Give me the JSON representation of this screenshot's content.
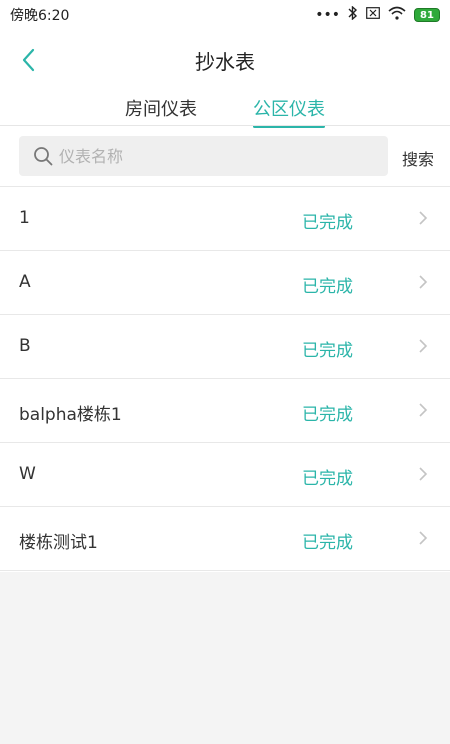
{
  "status_bar": {
    "time": "傍晚6:20",
    "icons": [
      "dots-icon",
      "bluetooth-icon",
      "sim-off-icon",
      "wifi-icon",
      "battery-icon"
    ],
    "battery_level": "81"
  },
  "header": {
    "title": "抄水表",
    "back_icon": "chevron-left-icon"
  },
  "tabs": [
    {
      "label": "房间仪表",
      "active": false
    },
    {
      "label": "公区仪表",
      "active": true
    }
  ],
  "search": {
    "placeholder": "仪表名称",
    "value": "",
    "button_label": "搜索"
  },
  "list": {
    "items": [
      {
        "name": "1",
        "status": "已完成"
      },
      {
        "name": "A",
        "status": "已完成"
      },
      {
        "name": "B",
        "status": "已完成"
      },
      {
        "name": "balpha楼栋1",
        "status": "已完成"
      },
      {
        "name": "W",
        "status": "已完成"
      },
      {
        "name": "楼栋测试1",
        "status": "已完成"
      }
    ]
  },
  "colors": {
    "accent": "#2bb5a9",
    "background": "#f4f4f4",
    "surface": "#ffffff"
  }
}
